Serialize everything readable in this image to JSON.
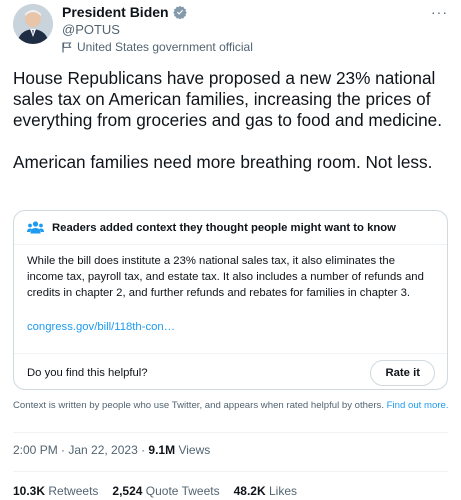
{
  "author": {
    "name": "President Biden",
    "handle": "@POTUS",
    "label": "United States government official"
  },
  "tweet": {
    "paragraphs": [
      "House Republicans have proposed a new 23% national sales tax on American families, increasing the prices of everything from groceries and gas to food and medicine.",
      "American families need more breathing room. Not less."
    ]
  },
  "context": {
    "header": "Readers added context they thought people might want to know",
    "body": "While the bill does institute a 23% national sales tax, it also eliminates the income tax, payroll tax, and estate tax. It also includes a number of refunds and credits in chapter 2, and further refunds and rebates for families in chapter 3.",
    "link": "congress.gov/bill/118th-con…",
    "question": "Do you find this helpful?",
    "rate_label": "Rate it",
    "note": "Context is written by people who use Twitter, and appears when rated helpful by others.",
    "note_link": "Find out more."
  },
  "meta": {
    "timestamp": "2:00 PM · Jan 22, 2023 · ",
    "views_count": "9.1M",
    "views_label": " Views"
  },
  "stats": {
    "retweets_count": "10.3K",
    "retweets_label": "Retweets",
    "quotes_count": "2,524",
    "quotes_label": "Quote Tweets",
    "likes_count": "48.2K",
    "likes_label": "Likes"
  },
  "icons": {
    "verified": "verified-badge-icon",
    "flag": "flag-icon",
    "more": "more-icon",
    "people": "people-icon"
  },
  "colors": {
    "accent": "#1d9bf0",
    "secondary_text": "#536471",
    "border": "#cfd9de"
  }
}
